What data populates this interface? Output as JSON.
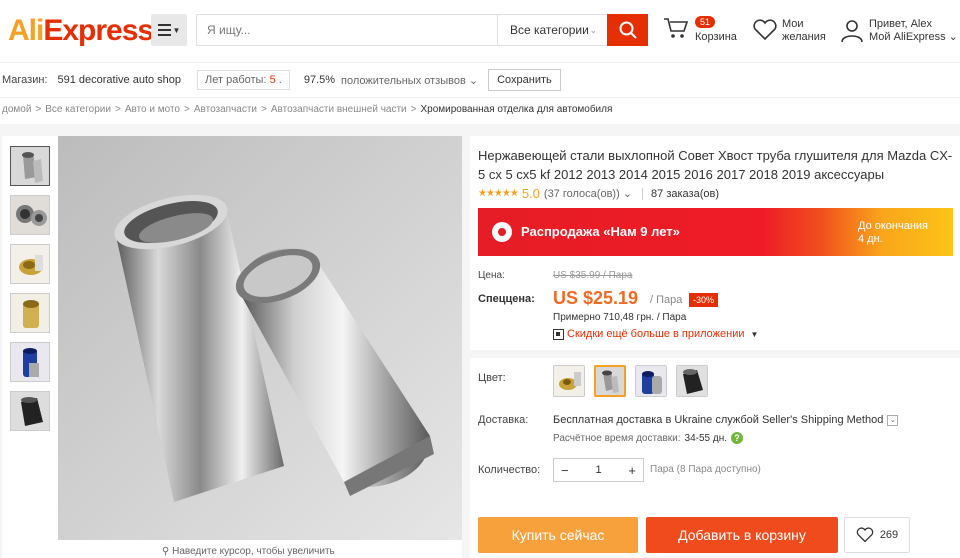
{
  "header": {
    "logo_ali": "Ali",
    "logo_express": "Express",
    "logo_tm": "™",
    "search_placeholder": "Я ищу...",
    "category_select": "Все категории",
    "cart_count": "51",
    "cart_label": "Корзина",
    "wishlist_line1": "Мои",
    "wishlist_line2": "желания",
    "account_line1": "Привет, Alex",
    "account_line2": "Мой AliExpress",
    "account_chevron": "⌄"
  },
  "store": {
    "label": "Магазин:",
    "name": "591 decorative auto shop",
    "years_label": "Лет работы:",
    "years_value": "5",
    "years_suffix": ".",
    "positive_pct": "97.5%",
    "positive_label": "положительных отзывов",
    "save_label": "Сохранить"
  },
  "breadcrumb": {
    "items": [
      "домой",
      "Все категории",
      "Авто и мото",
      "Автозапчасти",
      "Автозапчасти внешней части"
    ],
    "current": "Хромированная отделка для автомобиля",
    "sep": ">"
  },
  "gallery": {
    "zoom_hint": "Наведите курсор, чтобы увеличить"
  },
  "product": {
    "title": "Нержавеющей стали выхлопной Совет Хвост труба глушителя для Mazda CX-5 cx 5 cx5 kf 2012 2013 2014 2015 2016 2017 2018 2019 аксессуары",
    "stars": "★★★★★",
    "rating": "5.0",
    "votes": "(37 голоса(ов))",
    "votes_chevron": "⌄",
    "orders": "87 заказа(ов)",
    "promo_text": "Распродажа «Нам 9 лет»",
    "promo_ends_line1": "До окончания",
    "promo_ends_line2": "4 дн.",
    "price_label": "Цена:",
    "old_price": "US $35.99 / Пара",
    "special_label": "Спеццена:",
    "price": "US $25.19",
    "price_unit": "/ Пара",
    "discount": "-30%",
    "approx": "Примерно 710,48 грн. / Пара",
    "app_discount": "Скидки ещё больше в приложении",
    "color_label": "Цвет:",
    "shipping_label": "Доставка:",
    "shipping_text": "Бесплатная доставка в Ukraine службой Seller's Shipping Method",
    "eta_label": "Расчётное время доставки:",
    "eta_value": "34-55 дн.",
    "eta_help": "?",
    "qty_label": "Количество:",
    "qty_minus": "−",
    "qty_value": "1",
    "qty_plus": "+",
    "qty_info": "Пара (8 Пара доступно)",
    "buy_now": "Купить сейчас",
    "add_to_cart": "Добавить в корзину",
    "likes": "269"
  },
  "colors": {
    "brand_orange": "#f7a023",
    "brand_red": "#e62e04",
    "price_orange": "#f06a24"
  }
}
